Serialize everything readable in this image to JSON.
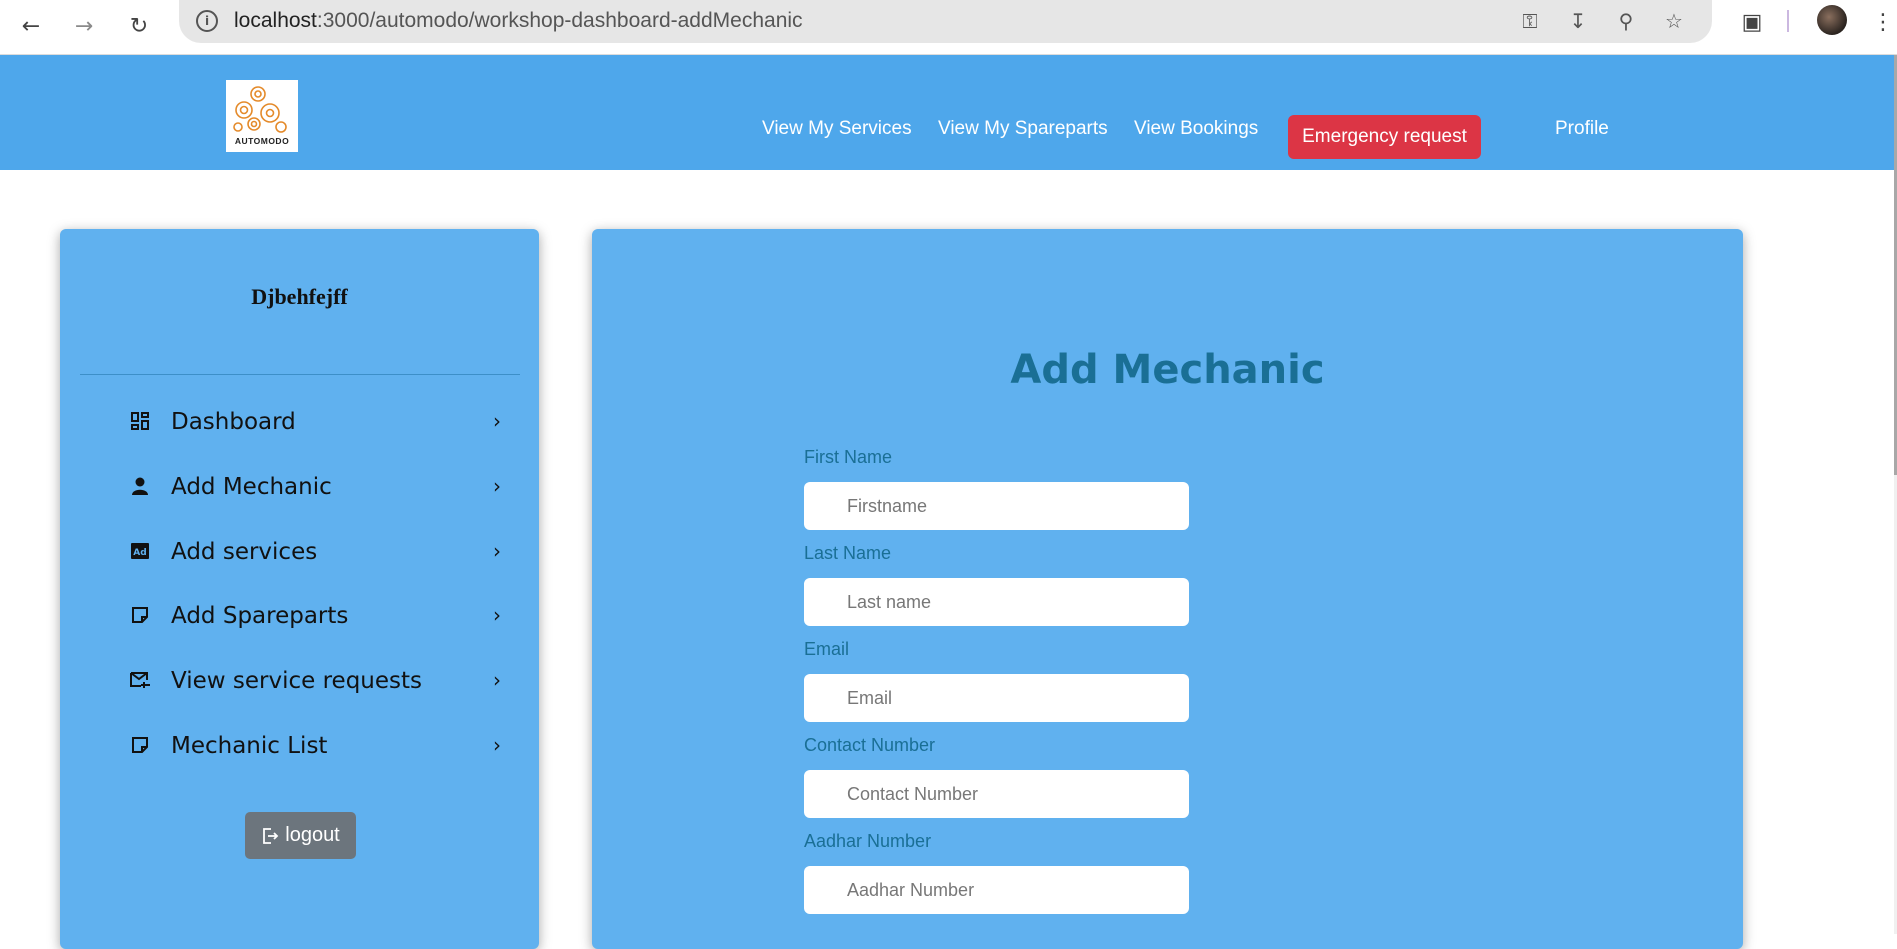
{
  "browser": {
    "url_host": "localhost",
    "url_rest": ":3000/automodo/workshop-dashboard-addMechanic"
  },
  "header": {
    "logo_text": "AUTOMODO",
    "nav": {
      "services": "View My Services",
      "spareparts": "View My Spareparts",
      "bookings": "View Bookings",
      "emergency": "Emergency request",
      "profile": "Profile"
    }
  },
  "sidebar": {
    "name": "Djbehfejff",
    "items": [
      {
        "label": "Dashboard",
        "icon": "dashboard-icon"
      },
      {
        "label": "Add Mechanic",
        "icon": "person-icon"
      },
      {
        "label": "Add services",
        "icon": "ad-icon"
      },
      {
        "label": "Add Spareparts",
        "icon": "note-icon"
      },
      {
        "label": "View service requests",
        "icon": "mail-icon"
      },
      {
        "label": "Mechanic List",
        "icon": "note-icon"
      }
    ],
    "logout": "logout"
  },
  "form": {
    "title": "Add Mechanic",
    "fields": [
      {
        "label": "First Name",
        "placeholder": "Firstname"
      },
      {
        "label": "Last Name",
        "placeholder": "Last name"
      },
      {
        "label": "Email",
        "placeholder": "Email"
      },
      {
        "label": "Contact Number",
        "placeholder": "Contact Number"
      },
      {
        "label": "Aadhar Number",
        "placeholder": "Aadhar Number"
      }
    ]
  },
  "colors": {
    "header_bg": "#4ea7eb",
    "panel_bg": "#60b1ef",
    "emergency": "#dc3545",
    "title": "#1a6f95",
    "logout": "#6c757d"
  }
}
